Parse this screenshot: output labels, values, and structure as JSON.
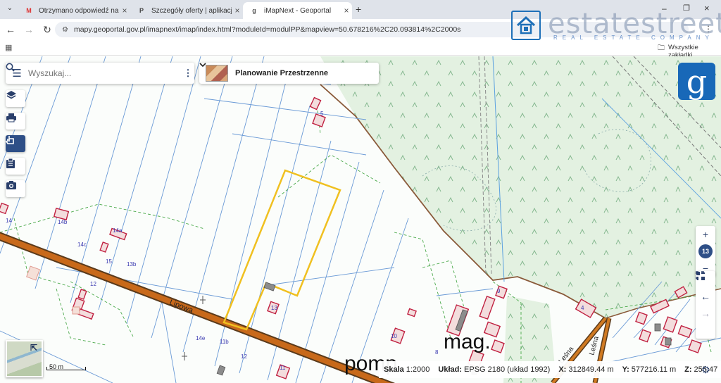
{
  "browser": {
    "tabs": [
      {
        "title": "Otrzymano odpowiedź na wiadomość",
        "favicon": "gmail-icon"
      },
      {
        "title": "Szczegóły oferty | aplikacja propertio",
        "favicon": "doc-icon"
      },
      {
        "title": "iMapNext - Geoportal",
        "favicon": "geoportal-icon"
      }
    ],
    "url": "mapy.geoportal.gov.pl/imapnext/imap/index.html?moduleId=modulPP&mapview=50.678216%2C20.093814%2C2000s",
    "bookmarks_label": "Wszystkie zakładki"
  },
  "watermark": {
    "name": "estatestreet",
    "sub": "REAL ESTATE COMPANY"
  },
  "app": {
    "search_placeholder": "Wyszukaj...",
    "theme_label": "Planowanie Przestrzenne",
    "logo_letter": "g",
    "zoom_level": "13"
  },
  "map": {
    "street_labels": [
      "Lipowa",
      "Leśna",
      "Leśna"
    ],
    "large_labels": [
      "mag.",
      "pomp."
    ],
    "parcel_numbers": [
      "5",
      "14",
      "14b",
      "14c",
      "15",
      "14a",
      "13b",
      "12",
      "13",
      "14e",
      "11b",
      "12",
      "11",
      "10",
      "8",
      "9",
      "4"
    ],
    "scale_bar_label": "50 m"
  },
  "status": {
    "scale_label": "Skala",
    "scale_value": "1:2000",
    "crs_label": "Układ:",
    "crs_value": "EPSG 2180 (układ 1992)",
    "x_label": "X:",
    "x_value": "312849.44 m",
    "y_label": "Y:",
    "y_value": "577216.11 m",
    "z_label": "Z:",
    "z_value": "255.47"
  },
  "colors": {
    "forest": "#e3f1e1",
    "road": "#c8691a",
    "parcel_highlight": "#f0c020",
    "accent": "#2e4f87",
    "logo": "#1868b8"
  }
}
